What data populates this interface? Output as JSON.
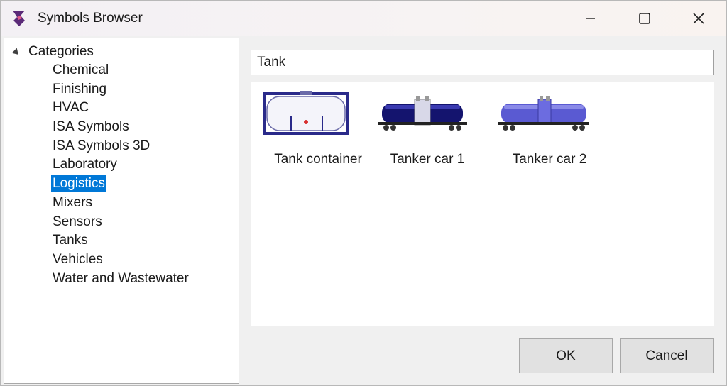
{
  "window": {
    "title": "Symbols Browser"
  },
  "tree": {
    "root_label": "Categories",
    "items": [
      {
        "label": "Chemical"
      },
      {
        "label": "Finishing"
      },
      {
        "label": "HVAC"
      },
      {
        "label": "ISA Symbols"
      },
      {
        "label": "ISA Symbols 3D"
      },
      {
        "label": "Laboratory"
      },
      {
        "label": "Logistics",
        "selected": true
      },
      {
        "label": "Mixers"
      },
      {
        "label": "Sensors"
      },
      {
        "label": "Tanks"
      },
      {
        "label": "Vehicles"
      },
      {
        "label": "Water and Wastewater"
      }
    ]
  },
  "search": {
    "value": "Tank"
  },
  "results": [
    {
      "label": "Tank container",
      "icon": "tank-container-icon"
    },
    {
      "label": "Tanker car 1",
      "icon": "tanker-car-1-icon"
    },
    {
      "label": "Tanker car 2",
      "icon": "tanker-car-2-icon"
    }
  ],
  "buttons": {
    "ok": "OK",
    "cancel": "Cancel"
  },
  "colors": {
    "selection": "#0078d7",
    "tanker_dark": "#14146e",
    "tanker_light": "#5a5ad2"
  }
}
